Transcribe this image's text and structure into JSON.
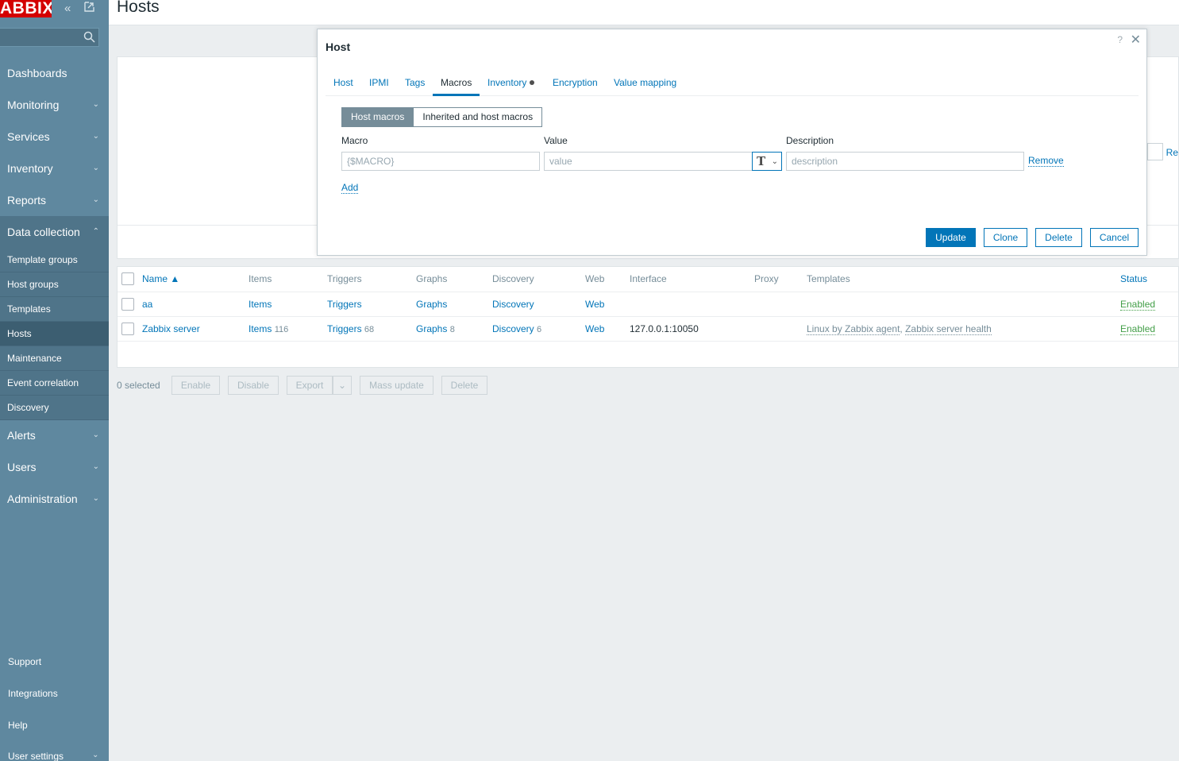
{
  "app": {
    "logo_text": "ABBIX",
    "page_title": "Hosts"
  },
  "sidebar": {
    "menu": [
      {
        "label": "Dashboards"
      },
      {
        "label": "Monitoring"
      },
      {
        "label": "Services"
      },
      {
        "label": "Inventory"
      },
      {
        "label": "Reports"
      },
      {
        "label": "Data collection"
      },
      {
        "label": "Alerts"
      },
      {
        "label": "Users"
      },
      {
        "label": "Administration"
      }
    ],
    "submenu": [
      {
        "label": "Template groups"
      },
      {
        "label": "Host groups"
      },
      {
        "label": "Templates"
      },
      {
        "label": "Hosts"
      },
      {
        "label": "Maintenance"
      },
      {
        "label": "Event correlation"
      },
      {
        "label": "Discovery"
      }
    ],
    "bottom": [
      {
        "label": "Support"
      },
      {
        "label": "Integrations"
      },
      {
        "label": "Help"
      },
      {
        "label": "User settings"
      }
    ]
  },
  "filter": {
    "partial_link": "Re"
  },
  "table": {
    "headers": {
      "name": "Name ▲",
      "items": "Items",
      "triggers": "Triggers",
      "graphs": "Graphs",
      "discovery": "Discovery",
      "web": "Web",
      "interface": "Interface",
      "proxy": "Proxy",
      "templates": "Templates",
      "status": "Status"
    },
    "rows": [
      {
        "name": "aa",
        "items": "Items",
        "items_count": "",
        "triggers": "Triggers",
        "triggers_count": "",
        "graphs": "Graphs",
        "graphs_count": "",
        "discovery": "Discovery",
        "discovery_count": "",
        "web": "Web",
        "interface": "",
        "template1": "",
        "template_sep": "",
        "template2": "",
        "status": "Enabled"
      },
      {
        "name": "Zabbix server",
        "items": "Items",
        "items_count": "116",
        "triggers": "Triggers",
        "triggers_count": "68",
        "graphs": "Graphs",
        "graphs_count": "8",
        "discovery": "Discovery",
        "discovery_count": "6",
        "web": "Web",
        "interface": "127.0.0.1:10050",
        "template1": "Linux by Zabbix agent",
        "template_sep": ", ",
        "template2": "Zabbix server health",
        "status": "Enabled"
      }
    ]
  },
  "actions": {
    "selected": "0 selected",
    "enable": "Enable",
    "disable": "Disable",
    "export": "Export",
    "mass_update": "Mass update",
    "delete": "Delete"
  },
  "dialog": {
    "title": "Host",
    "help": "?",
    "tabs": [
      {
        "label": "Host"
      },
      {
        "label": "IPMI"
      },
      {
        "label": "Tags"
      },
      {
        "label": "Macros"
      },
      {
        "label": "Inventory"
      },
      {
        "label": "Encryption"
      },
      {
        "label": "Value mapping"
      }
    ],
    "active_tab": "Macros",
    "toggle": {
      "host_macros": "Host macros",
      "inherited": "Inherited and host macros"
    },
    "columns": {
      "macro": "Macro",
      "value": "Value",
      "description": "Description"
    },
    "placeholders": {
      "macro": "{$MACRO}",
      "value": "value",
      "description": "description"
    },
    "value_type_glyph": "T",
    "remove": "Remove",
    "add": "Add",
    "buttons": {
      "update": "Update",
      "clone": "Clone",
      "delete": "Delete",
      "cancel": "Cancel"
    }
  },
  "colors": {
    "sidebar": "#5f889f",
    "accent": "#0275b8",
    "logo": "#d40000",
    "status_enabled": "#429e47"
  }
}
